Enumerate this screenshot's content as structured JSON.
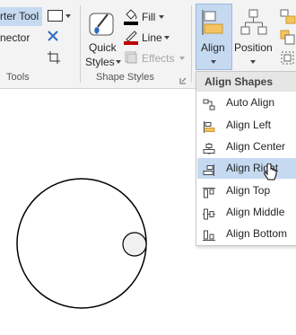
{
  "ribbon": {
    "connector_tool": "rter Tool",
    "connector": "nector",
    "tools_label": "Tools",
    "quick_styles_line1": "Quick",
    "quick_styles_line2": "Styles",
    "fill": "Fill",
    "line": "Line",
    "effects": "Effects",
    "shape_styles_label": "Shape Styles",
    "align": "Align",
    "position": "Position"
  },
  "align_menu": {
    "title": "Align Shapes",
    "items": [
      {
        "label": "Auto Align",
        "selected": false
      },
      {
        "label": "Align Left",
        "selected": false
      },
      {
        "label": "Align Center",
        "selected": false
      },
      {
        "label": "Align Right",
        "selected": true
      },
      {
        "label": "Align Top",
        "selected": false
      },
      {
        "label": "Align Middle",
        "selected": false
      },
      {
        "label": "Align Bottom",
        "selected": false
      }
    ]
  },
  "colors": {
    "accent": "#c5d9f1",
    "ribbon_bg": "#f3f3f3",
    "fill_swatch": "#000000",
    "line_swatch": "#c00000"
  }
}
